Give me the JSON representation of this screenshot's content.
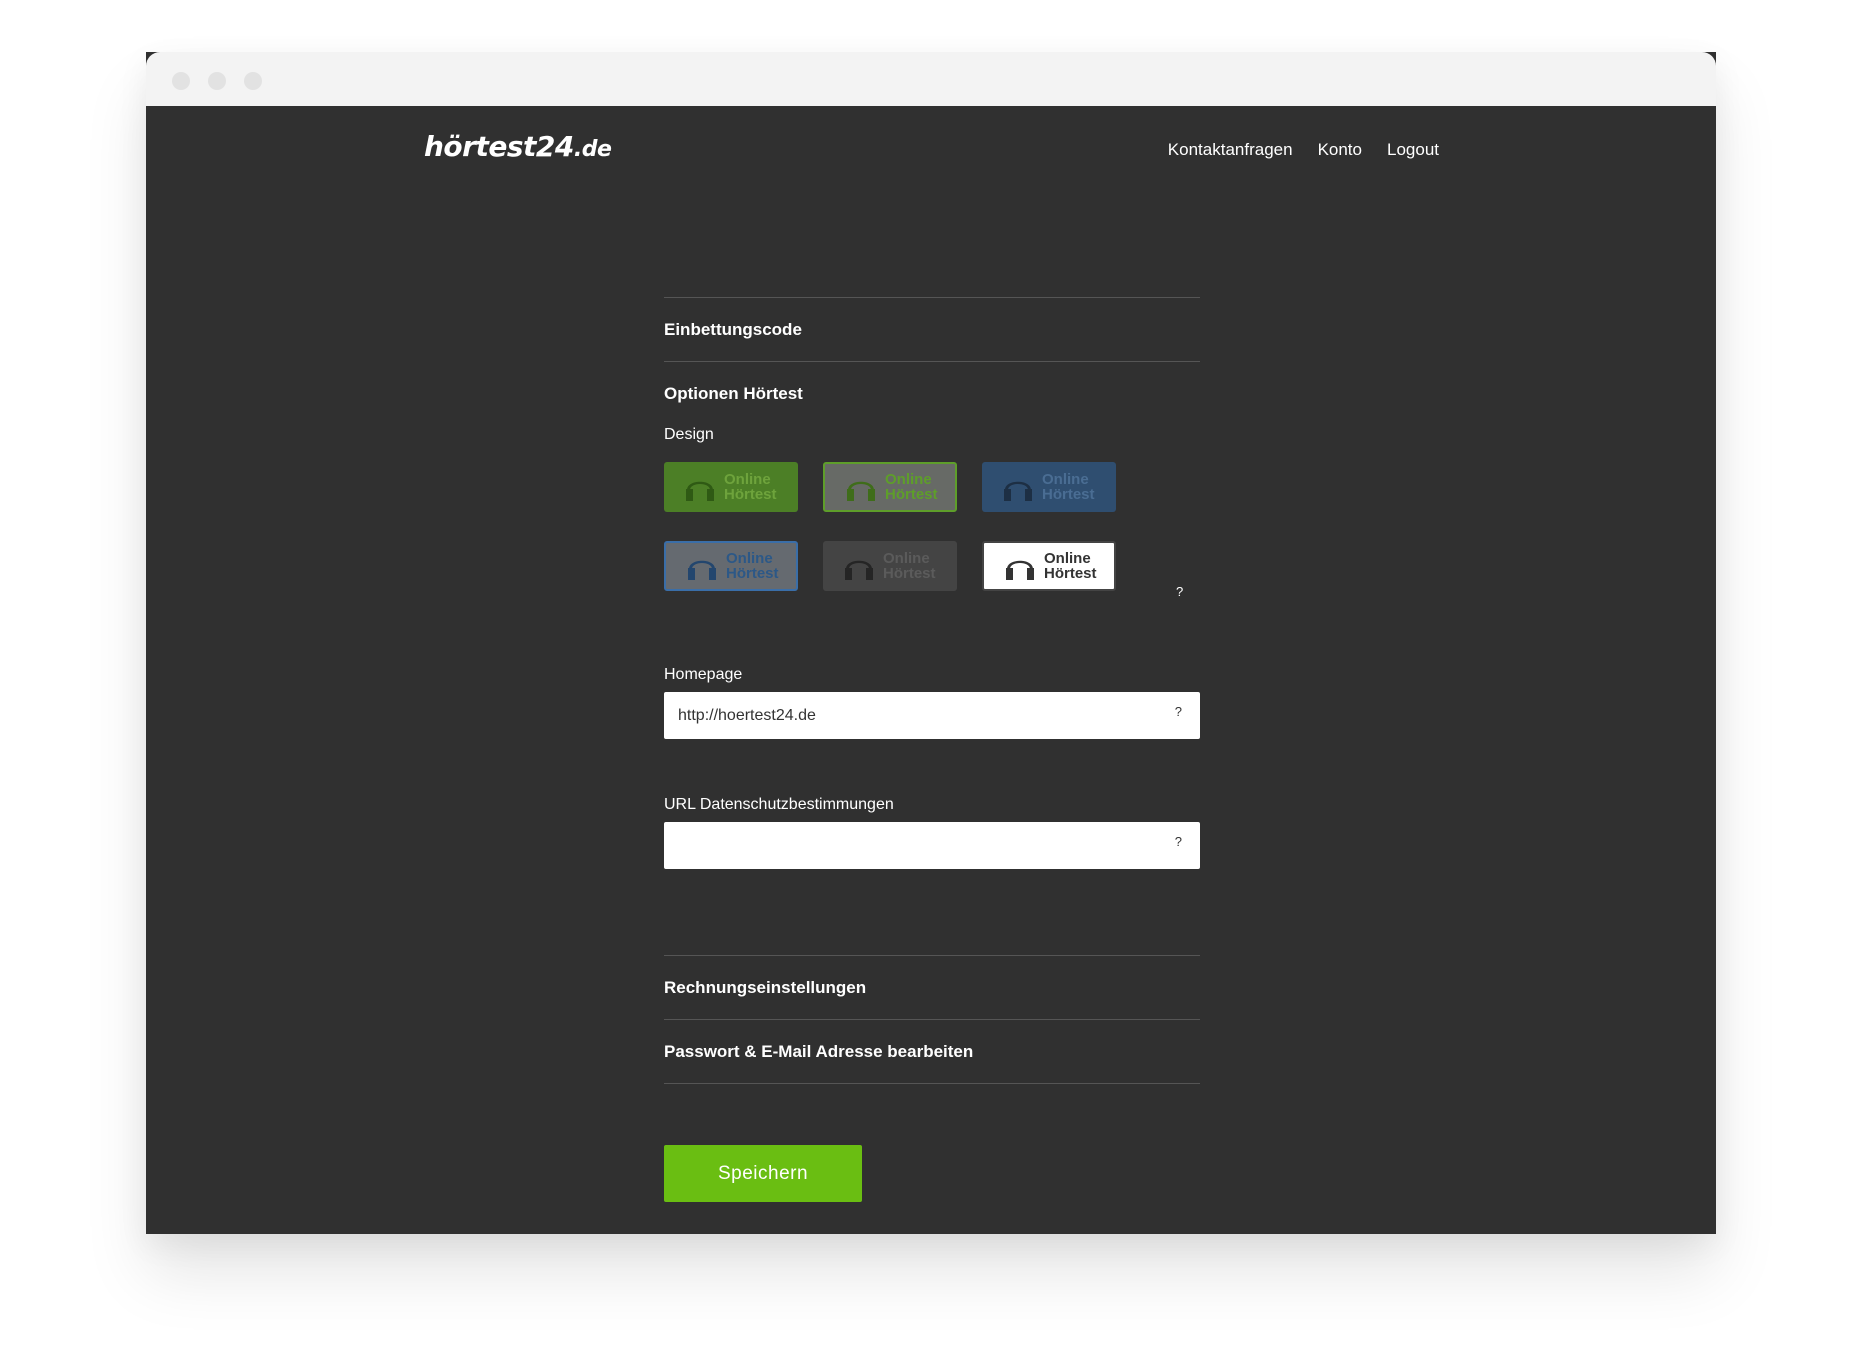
{
  "logo": {
    "main": "hörtest24",
    "tld": ".de"
  },
  "nav": [
    {
      "label": "Kontaktanfragen"
    },
    {
      "label": "Konto"
    },
    {
      "label": "Logout"
    }
  ],
  "sections": {
    "embed": "Einbettungscode",
    "options": "Optionen Hörtest",
    "billing": "Rechnungseinstellungen",
    "password": "Passwort & E-Mail Adresse bearbeiten"
  },
  "design": {
    "label": "Design",
    "help": "?",
    "buttons": [
      {
        "line1": "Online",
        "line2": "Hörtest",
        "style": "green-filled",
        "color": "#4c7f26"
      },
      {
        "line1": "Online",
        "line2": "Hörtest",
        "style": "green-outline",
        "color": "#5e9e2a"
      },
      {
        "line1": "Online",
        "line2": "Hörtest",
        "style": "blue-filled",
        "color": "#2f4e70"
      },
      {
        "line1": "Online",
        "line2": "Hörtest",
        "style": "blue-outline",
        "color": "#3a6ea8"
      },
      {
        "line1": "Online",
        "line2": "Hörtest",
        "style": "dark",
        "color": "#444444"
      },
      {
        "line1": "Online",
        "line2": "Hörtest",
        "style": "white-selected",
        "color": "#ffffff"
      }
    ],
    "icon": "headphones-icon"
  },
  "homepage": {
    "label": "Homepage",
    "value": "http://hoertest24.de",
    "help": "?"
  },
  "privacy": {
    "label": "URL Datenschutzbestimmungen",
    "value": "",
    "help": "?"
  },
  "save_label": "Speichern",
  "colors": {
    "background": "#303030",
    "accent": "#6abe12"
  }
}
